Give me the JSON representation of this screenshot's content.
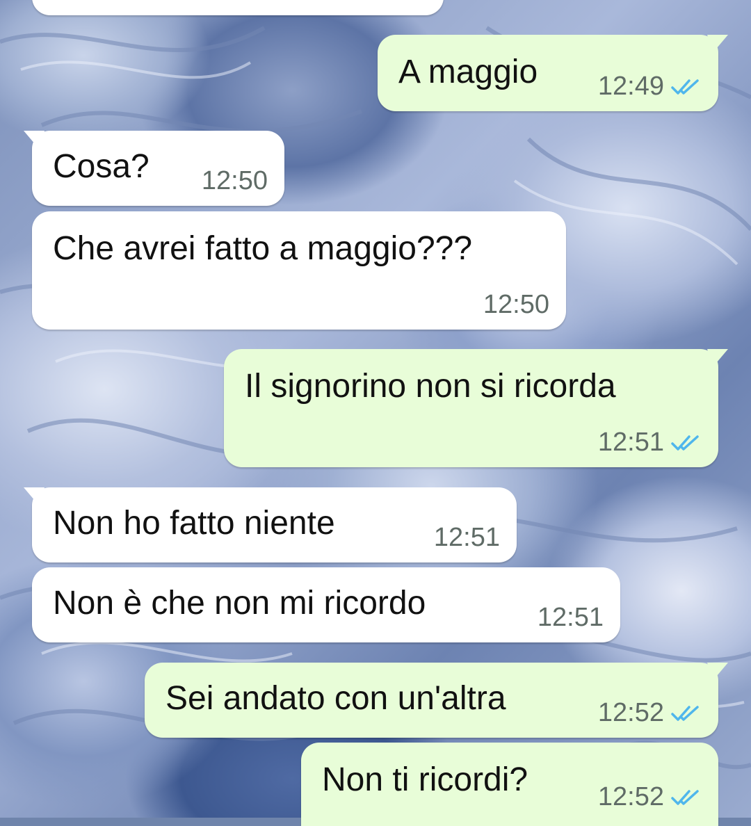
{
  "chat": {
    "messages": [
      {
        "text": "A maggio",
        "time": "12:49",
        "dir": "out",
        "status": "read"
      },
      {
        "text": "Cosa?",
        "time": "12:50",
        "dir": "in"
      },
      {
        "text": "Che avrei fatto a maggio???",
        "time": "12:50",
        "dir": "in"
      },
      {
        "text": "Il signorino non si ricorda",
        "time": "12:51",
        "dir": "out",
        "status": "read"
      },
      {
        "text": "Non ho fatto niente",
        "time": "12:51",
        "dir": "in"
      },
      {
        "text": "Non è che non mi ricordo",
        "time": "12:51",
        "dir": "in"
      },
      {
        "text": "Sei andato con un'altra",
        "time": "12:52",
        "dir": "out",
        "status": "read"
      },
      {
        "text": "Non ti ricordi?",
        "time": "12:52",
        "dir": "out",
        "status": "read"
      }
    ]
  },
  "colors": {
    "incoming_bubble": "#ffffff",
    "outgoing_bubble": "#e8fdd8",
    "read_ticks": "#4fb6ec",
    "timestamp": "#5f6b66"
  },
  "icons": {
    "read_receipt": "double-check-icon"
  }
}
